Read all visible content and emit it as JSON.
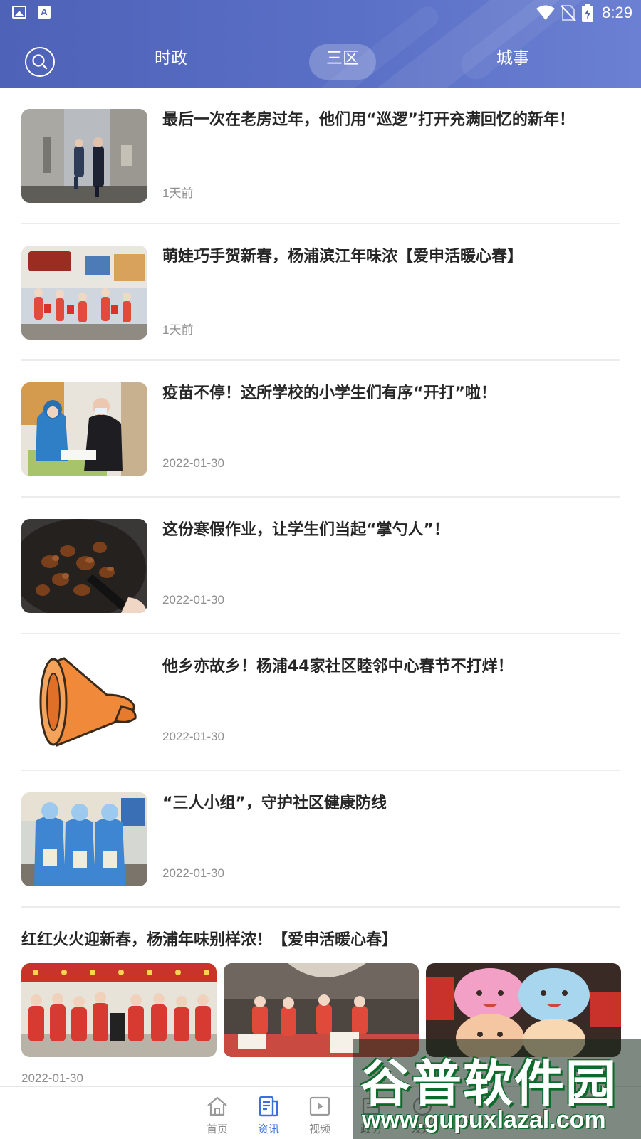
{
  "status_bar": {
    "time": "8:29",
    "icons": [
      "image-icon",
      "a-icon",
      "wifi-icon",
      "no-sim-icon",
      "battery-charging-icon"
    ]
  },
  "header": {
    "search_icon": "search-icon",
    "tabs": [
      {
        "label": "时政",
        "active": false
      },
      {
        "label": "三区",
        "active": true
      },
      {
        "label": "城事",
        "active": false
      }
    ],
    "colors": {
      "gradient_start": "#4e62b7",
      "gradient_end": "#6b80d2"
    }
  },
  "news": [
    {
      "title": "最后一次在老房过年，他们用“巡逻”打开充满回忆的新年！",
      "date": "1天前"
    },
    {
      "title": "萌娃巧手贺新春，杨浦滨江年味浓【爱申活暖心春】",
      "date": "1天前"
    },
    {
      "title": "疫苗不停！这所学校的小学生们有序“开打”啦！",
      "date": "2022-01-30"
    },
    {
      "title": "这份寒假作业，让学生们当起“掌勺人”！",
      "date": "2022-01-30"
    },
    {
      "title": "他乡亦故乡！杨浦44家社区睦邻中心春节不打烊！",
      "date": "2022-01-30"
    },
    {
      "title": "“三人小组”，守护社区健康防线",
      "date": "2022-01-30"
    }
  ],
  "feature": {
    "title": "红红火火迎新春，杨浦年味别样浓！【爱申活暖心春】",
    "date": "2022-01-30"
  },
  "bottom_nav": {
    "items": [
      {
        "label": "首页",
        "icon": "home-icon",
        "active": false
      },
      {
        "label": "资讯",
        "icon": "news-icon",
        "active": true
      },
      {
        "label": "视频",
        "icon": "video-icon",
        "active": false
      },
      {
        "label": "政务",
        "icon": "government-icon",
        "active": false
      },
      {
        "label": "发现",
        "icon": "discover-icon",
        "active": false
      }
    ],
    "active_color": "#3b6fe0"
  },
  "watermark": {
    "text": "谷普软件园",
    "url": "www.gupuxlazal.com"
  }
}
